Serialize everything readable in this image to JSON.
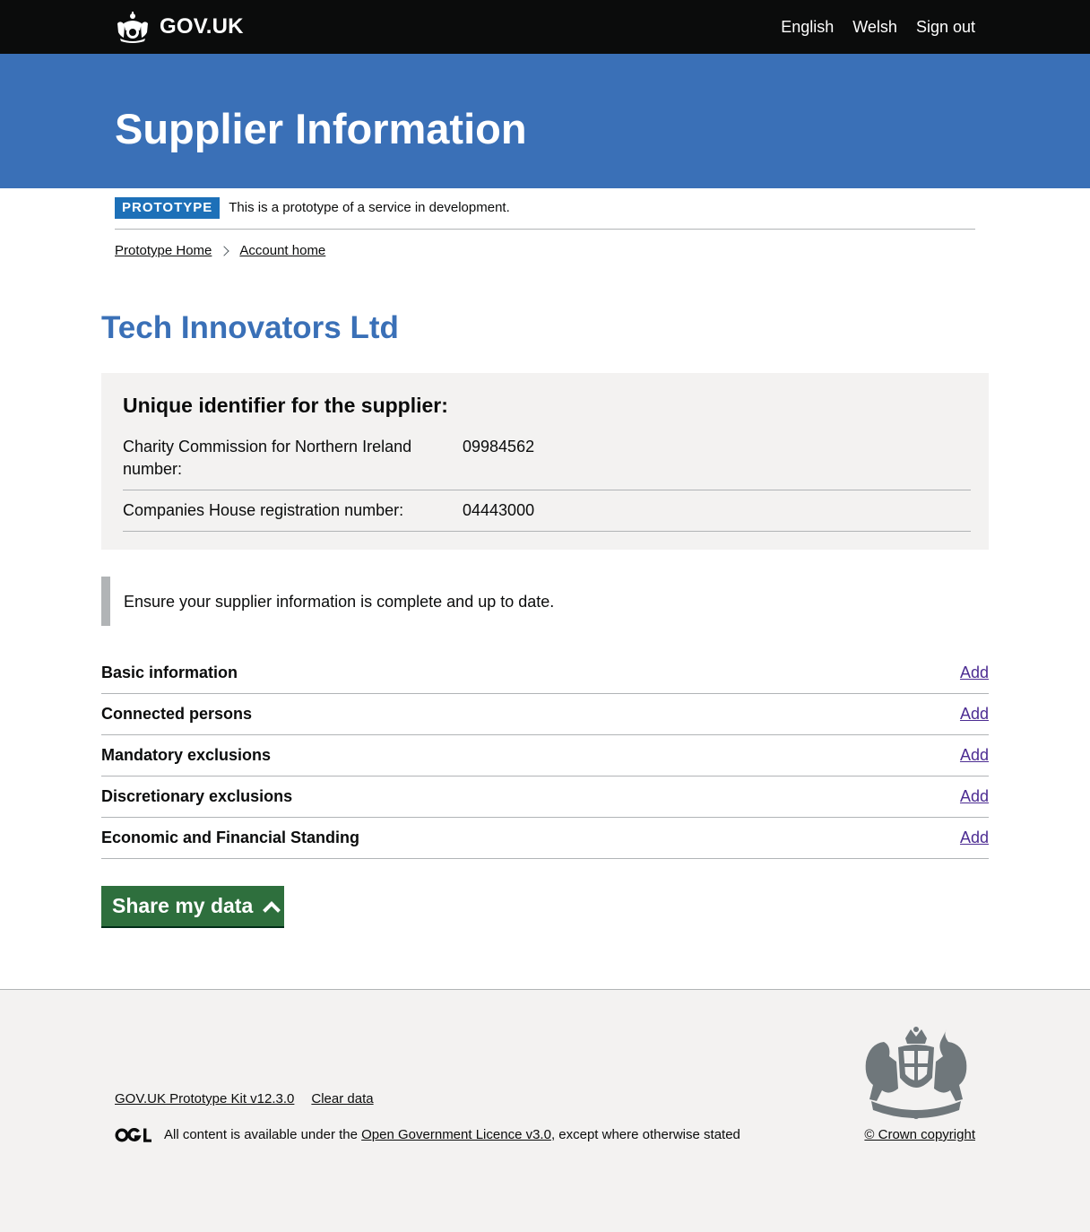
{
  "header": {
    "logo_text": "GOV.UK",
    "nav": [
      "English",
      "Welsh",
      "Sign out"
    ]
  },
  "banner": {
    "title": "Supplier Information"
  },
  "phase": {
    "tag": "PROTOTYPE",
    "text": "This is a prototype of a service in development."
  },
  "breadcrumbs": [
    "Prototype Home",
    "Account home"
  ],
  "supplier": {
    "name": "Tech Innovators Ltd",
    "identifiers_heading": "Unique identifier for the supplier:",
    "identifiers": [
      {
        "label": "Charity Commission for Northern Ireland number:",
        "value": "09984562"
      },
      {
        "label": "Companies House registration number:",
        "value": "04443000"
      }
    ]
  },
  "inset_text": "Ensure your supplier information is complete and up to date.",
  "tasks": [
    {
      "name": "Basic information",
      "action": "Add"
    },
    {
      "name": "Connected persons",
      "action": "Add"
    },
    {
      "name": "Mandatory exclusions",
      "action": "Add"
    },
    {
      "name": "Discretionary exclusions",
      "action": "Add"
    },
    {
      "name": "Economic and Financial Standing",
      "action": "Add"
    }
  ],
  "share_button": "Share my data",
  "footer": {
    "links": [
      "GOV.UK Prototype Kit v12.3.0",
      "Clear data"
    ],
    "licence_prefix": "All content is available under the ",
    "licence_link": "Open Government Licence v3.0",
    "licence_suffix": ", except where otherwise stated",
    "copyright": "© Crown copyright"
  },
  "colors": {
    "header_bg": "#0b0c0c",
    "banner_bg": "#3a70b7",
    "phase_tag": "#1d70b8",
    "link": "#4c2c92",
    "button_green": "#2e6f3d",
    "panel_grey": "#f3f2f1"
  },
  "icons": [
    "crown-icon",
    "chevron-right-icon",
    "chevron-up-icon",
    "ogl-icon",
    "royal-coat-of-arms-icon"
  ]
}
